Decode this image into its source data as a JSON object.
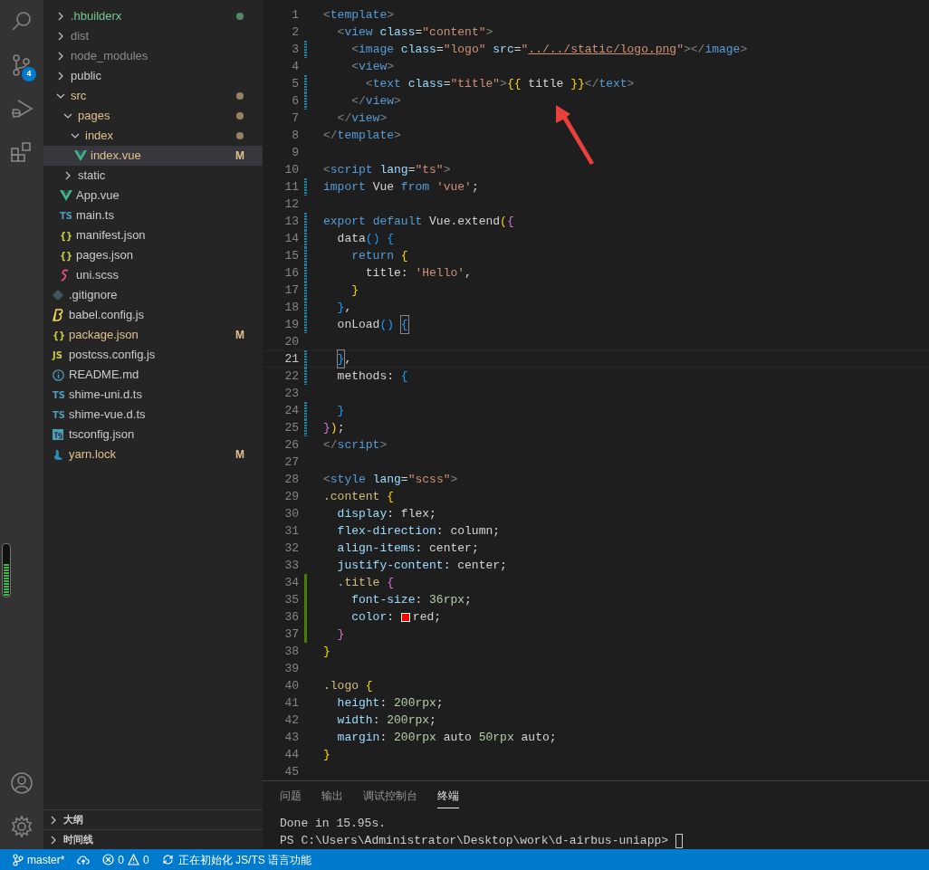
{
  "activity_bar": {
    "items": [
      {
        "kind": "search"
      },
      {
        "kind": "source-control",
        "badge": "4"
      },
      {
        "kind": "debug"
      },
      {
        "kind": "extensions"
      }
    ],
    "bottom_items": [
      {
        "kind": "account"
      },
      {
        "kind": "settings"
      }
    ]
  },
  "level_meter": {
    "level": 0.62
  },
  "explorer": {
    "tree": [
      {
        "name": ".hbuilderx",
        "kind": "folder",
        "expanded": false,
        "color": "#73c991",
        "dot": true,
        "selected": false
      },
      {
        "name": "dist",
        "kind": "folder",
        "expanded": false,
        "color": "#8c8c8c",
        "dot": false,
        "selected": false
      },
      {
        "name": "node_modules",
        "kind": "folder",
        "expanded": false,
        "color": "#8c8c8c",
        "dot": false,
        "selected": false
      },
      {
        "name": "public",
        "kind": "folder",
        "expanded": false,
        "color": "#cccccc",
        "dot": false,
        "selected": false
      },
      {
        "name": "src",
        "kind": "folder",
        "expanded": true,
        "color": "#e2c08d",
        "dot": true,
        "selected": false,
        "children": [
          {
            "name": "pages",
            "kind": "folder",
            "expanded": true,
            "color": "#e2c08d",
            "dot": true,
            "selected": false,
            "children": [
              {
                "name": "index",
                "kind": "folder",
                "expanded": true,
                "color": "#e2c08d",
                "dot": true,
                "selected": false,
                "children": [
                  {
                    "name": "index.vue",
                    "kind": "vue",
                    "color": "#e2c08d",
                    "decoration": "M",
                    "selected": true
                  }
                ]
              }
            ]
          },
          {
            "name": "static",
            "kind": "folder",
            "expanded": false,
            "color": "#cccccc",
            "dot": false,
            "selected": false
          },
          {
            "name": "App.vue",
            "kind": "vue",
            "color": "#cccccc",
            "selected": false
          },
          {
            "name": "main.ts",
            "kind": "ts",
            "icon_label": "TS",
            "color": "#cccccc",
            "selected": false
          },
          {
            "name": "manifest.json",
            "kind": "json",
            "icon_label": "{}",
            "color": "#cccccc",
            "selected": false
          },
          {
            "name": "pages.json",
            "kind": "json",
            "icon_label": "{}",
            "color": "#cccccc",
            "selected": false
          },
          {
            "name": "uni.scss",
            "kind": "scss",
            "color": "#cccccc",
            "selected": false
          }
        ]
      },
      {
        "name": ".gitignore",
        "kind": "git",
        "color": "#cccccc",
        "selected": false
      },
      {
        "name": "babel.config.js",
        "kind": "babel",
        "color": "#cccccc",
        "selected": false
      },
      {
        "name": "package.json",
        "kind": "json",
        "icon_label": "{}",
        "color": "#e2c08d",
        "decoration": "M",
        "selected": false
      },
      {
        "name": "postcss.config.js",
        "kind": "js",
        "icon_label": "JS",
        "color": "#cccccc",
        "selected": false
      },
      {
        "name": "README.md",
        "kind": "info",
        "color": "#cccccc",
        "selected": false
      },
      {
        "name": "shime-uni.d.ts",
        "kind": "ts",
        "icon_label": "TS",
        "color": "#cccccc",
        "selected": false
      },
      {
        "name": "shime-vue.d.ts",
        "kind": "ts",
        "icon_label": "TS",
        "color": "#cccccc",
        "selected": false
      },
      {
        "name": "tsconfig.json",
        "kind": "tsconfig",
        "color": "#cccccc",
        "selected": false
      },
      {
        "name": "yarn.lock",
        "kind": "yarn",
        "color": "#e2c08d",
        "decoration": "M",
        "selected": false
      }
    ],
    "sections": [
      {
        "title": "大纲",
        "expanded": false
      },
      {
        "title": "时间线",
        "expanded": false
      }
    ]
  },
  "editor": {
    "lines": [
      {
        "number": "1",
        "kind": "markup",
        "modified": false,
        "added": false,
        "current": false,
        "bracket_match": false,
        "text": "<template>"
      },
      {
        "number": "2",
        "kind": "markup",
        "modified": false,
        "added": false,
        "current": false,
        "bracket_match": false,
        "text": "  <view class=\"content\">"
      },
      {
        "number": "3",
        "kind": "markup",
        "modified": true,
        "added": false,
        "current": false,
        "bracket_match": false,
        "text": "    <image class=\"logo\" src=\"../../static/logo.png\"></image>"
      },
      {
        "number": "4",
        "kind": "markup",
        "modified": false,
        "added": false,
        "current": false,
        "bracket_match": false,
        "text": "    <view>"
      },
      {
        "number": "5",
        "kind": "markup",
        "modified": true,
        "added": false,
        "current": false,
        "bracket_match": false,
        "text": "      <text class=\"title\">{{ title }}</text>"
      },
      {
        "number": "6",
        "kind": "markup",
        "modified": true,
        "added": false,
        "current": false,
        "bracket_match": false,
        "text": "    </view>"
      },
      {
        "number": "7",
        "kind": "markup",
        "modified": false,
        "added": false,
        "current": false,
        "bracket_match": false,
        "text": "  </view>"
      },
      {
        "number": "8",
        "kind": "markup",
        "modified": false,
        "added": false,
        "current": false,
        "bracket_match": false,
        "text": "</template>"
      },
      {
        "number": "9",
        "modified": false,
        "added": false,
        "current": false,
        "bracket_match": false
      },
      {
        "number": "10",
        "kind": "markup",
        "modified": false,
        "added": false,
        "current": false,
        "bracket_match": false,
        "text": "<script lang=\"ts\">"
      },
      {
        "number": "11",
        "kind": "script",
        "modified": true,
        "added": false,
        "current": false,
        "bracket_match": false,
        "text": "import Vue from 'vue';"
      },
      {
        "number": "12",
        "modified": false,
        "added": false,
        "current": false,
        "bracket_match": false
      },
      {
        "number": "13",
        "kind": "script",
        "modified": true,
        "added": false,
        "current": false,
        "bracket_match": false,
        "text": "export default Vue.extend({"
      },
      {
        "number": "14",
        "kind": "script",
        "modified": true,
        "added": false,
        "current": false,
        "bracket_match": false,
        "text": "  data() {"
      },
      {
        "number": "15",
        "kind": "script",
        "modified": true,
        "added": false,
        "current": false,
        "bracket_match": false,
        "text": "    return {"
      },
      {
        "number": "16",
        "kind": "script",
        "modified": true,
        "added": false,
        "current": false,
        "bracket_match": false,
        "text": "      title: 'Hello',"
      },
      {
        "number": "17",
        "kind": "script",
        "modified": true,
        "added": false,
        "current": false,
        "bracket_match": false,
        "text": "    }"
      },
      {
        "number": "18",
        "kind": "script",
        "modified": true,
        "added": false,
        "current": false,
        "bracket_match": false,
        "text": "  },"
      },
      {
        "number": "19",
        "kind": "script",
        "modified": true,
        "added": false,
        "current": false,
        "bracket_match": true,
        "text": "  onLoad() {"
      },
      {
        "number": "20",
        "modified": false,
        "added": false,
        "current": false,
        "bracket_match": false
      },
      {
        "number": "21",
        "kind": "script",
        "modified": true,
        "added": false,
        "current": true,
        "bracket_match": true,
        "text": "  },"
      },
      {
        "number": "22",
        "kind": "script",
        "modified": true,
        "added": false,
        "current": false,
        "bracket_match": false,
        "text": "  methods: {"
      },
      {
        "number": "23",
        "modified": false,
        "added": false,
        "current": false,
        "bracket_match": false
      },
      {
        "number": "24",
        "kind": "script",
        "modified": true,
        "added": false,
        "current": false,
        "bracket_match": false,
        "text": "  }"
      },
      {
        "number": "25",
        "kind": "script",
        "modified": true,
        "added": false,
        "current": false,
        "bracket_match": false,
        "text": "});"
      },
      {
        "number": "26",
        "kind": "markup",
        "modified": false,
        "added": false,
        "current": false,
        "bracket_match": false,
        "text": "</script>"
      },
      {
        "number": "27",
        "modified": false,
        "added": false,
        "current": false,
        "bracket_match": false
      },
      {
        "number": "28",
        "kind": "markup",
        "modified": false,
        "added": false,
        "current": false,
        "bracket_match": false,
        "text": "<style lang=\"scss\">"
      },
      {
        "number": "29",
        "kind": "style",
        "modified": false,
        "added": false,
        "current": false,
        "bracket_match": false,
        "text": ".content {"
      },
      {
        "number": "30",
        "kind": "style",
        "modified": false,
        "added": false,
        "current": false,
        "bracket_match": false,
        "text": "  display: flex;"
      },
      {
        "number": "31",
        "kind": "style",
        "modified": false,
        "added": false,
        "current": false,
        "bracket_match": false,
        "text": "  flex-direction: column;"
      },
      {
        "number": "32",
        "kind": "style",
        "modified": false,
        "added": false,
        "current": false,
        "bracket_match": false,
        "text": "  align-items: center;"
      },
      {
        "number": "33",
        "kind": "style",
        "modified": false,
        "added": false,
        "current": false,
        "bracket_match": false,
        "text": "  justify-content: center;"
      },
      {
        "number": "34",
        "kind": "style",
        "modified": false,
        "added": true,
        "current": false,
        "bracket_match": false,
        "text": "  .title {"
      },
      {
        "number": "35",
        "kind": "style",
        "modified": false,
        "added": true,
        "current": false,
        "bracket_match": false,
        "text": "    font-size: 36rpx;"
      },
      {
        "number": "36",
        "kind": "style",
        "modified": false,
        "added": true,
        "current": false,
        "bracket_match": false,
        "text": "    color: red;",
        "color": "#ff0000"
      },
      {
        "number": "37",
        "kind": "style",
        "modified": false,
        "added": true,
        "current": false,
        "bracket_match": false,
        "text": "  }"
      },
      {
        "number": "38",
        "kind": "style",
        "modified": false,
        "added": false,
        "current": false,
        "bracket_match": false,
        "text": "}"
      },
      {
        "number": "39",
        "modified": false,
        "added": false,
        "current": false,
        "bracket_match": false
      },
      {
        "number": "40",
        "kind": "style",
        "modified": false,
        "added": false,
        "current": false,
        "bracket_match": false,
        "text": ".logo {"
      },
      {
        "number": "41",
        "kind": "style",
        "modified": false,
        "added": false,
        "current": false,
        "bracket_match": false,
        "text": "  height: 200rpx;"
      },
      {
        "number": "42",
        "kind": "style",
        "modified": false,
        "added": false,
        "current": false,
        "bracket_match": false,
        "text": "  width: 200rpx;"
      },
      {
        "number": "43",
        "kind": "style",
        "modified": false,
        "added": false,
        "current": false,
        "bracket_match": false,
        "text": "  margin: 200rpx auto 50rpx auto;"
      },
      {
        "number": "44",
        "kind": "style",
        "modified": false,
        "added": false,
        "current": false,
        "bracket_match": false,
        "text": "}"
      },
      {
        "number": "45",
        "modified": false,
        "added": false,
        "current": false,
        "bracket_match": false
      }
    ],
    "annotation": {
      "kind": "arrow"
    }
  },
  "panel": {
    "tabs": [
      {
        "label": "问题",
        "selected": false
      },
      {
        "label": "输出",
        "selected": false
      },
      {
        "label": "调试控制台",
        "selected": false
      },
      {
        "label": "终端",
        "selected": true
      }
    ],
    "terminal_lines": [
      "Done in 15.95s.",
      "PS C:\\Users\\Administrator\\Desktop\\work\\d-airbus-uniapp>"
    ]
  },
  "status_bar": {
    "branch": "master*",
    "errors": "0",
    "warnings": "0",
    "message": "正在初始化 JS/TS 语言功能"
  }
}
